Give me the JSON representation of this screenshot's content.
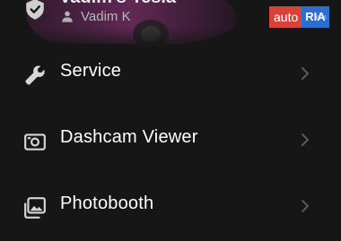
{
  "header": {
    "user_name": "Vadim K",
    "partial_title": "Vadim's Tesla"
  },
  "watermark": {
    "left_text": "auto",
    "right_text": "RIA",
    "suffix": ".com"
  },
  "menu": {
    "items": [
      {
        "label": "Service",
        "icon": "wrench-icon"
      },
      {
        "label": "Dashcam Viewer",
        "icon": "dashcam-icon"
      },
      {
        "label": "Photobooth",
        "icon": "photo-icon"
      }
    ]
  },
  "colors": {
    "background": "#161616",
    "text": "#ffffff",
    "muted": "#b8b8b8",
    "chevron": "#5a5a5a",
    "car_accent": "#7a2f6b",
    "watermark_red": "#d9423b",
    "watermark_blue": "#2d6fd0"
  }
}
